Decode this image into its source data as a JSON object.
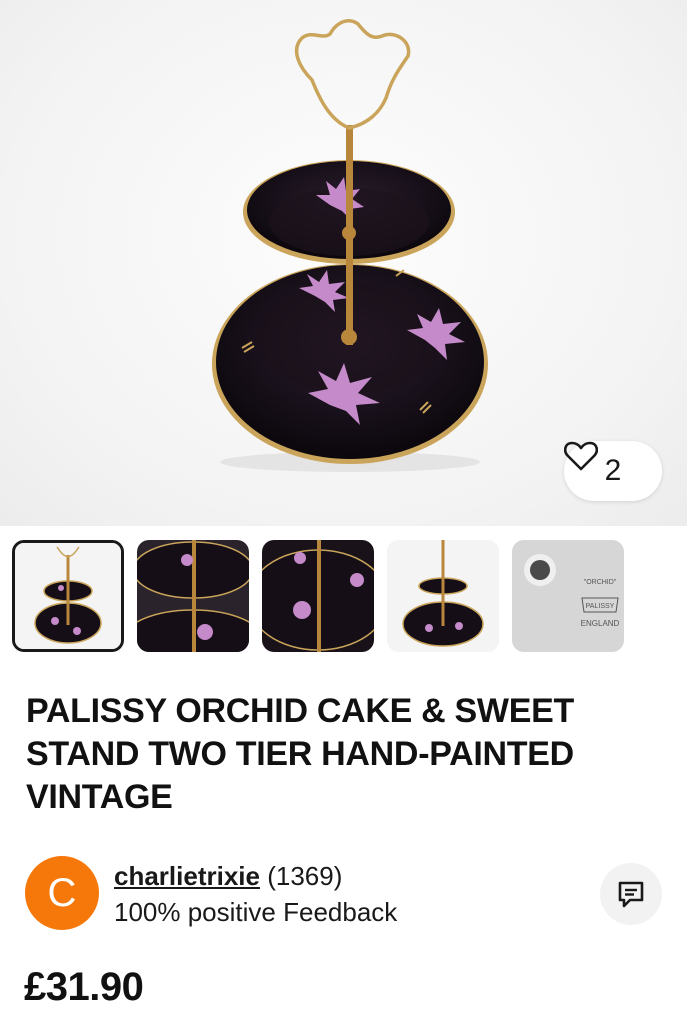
{
  "gallery": {
    "watch_count": "2",
    "watch_icon": "heart-outline-icon",
    "thumbnails": [
      {
        "name": "thumbnail-1",
        "selected": true
      },
      {
        "name": "thumbnail-2",
        "selected": false
      },
      {
        "name": "thumbnail-3",
        "selected": false
      },
      {
        "name": "thumbnail-4",
        "selected": false
      },
      {
        "name": "thumbnail-5",
        "selected": false
      }
    ],
    "backstamp": {
      "line1": "\"ORCHID\"",
      "line2": "PALISSY",
      "line3": "ENGLAND"
    }
  },
  "listing": {
    "title": "PALISSY ORCHID CAKE & SWEET STAND TWO TIER HAND-PAINTED VINTAGE",
    "price": "£31.90"
  },
  "seller": {
    "avatar_letter": "C",
    "avatar_color": "#f7780a",
    "username": "charlietrixie",
    "feedback_count": "(1369)",
    "feedback_text": "100% positive Feedback",
    "message_icon": "message-icon"
  }
}
